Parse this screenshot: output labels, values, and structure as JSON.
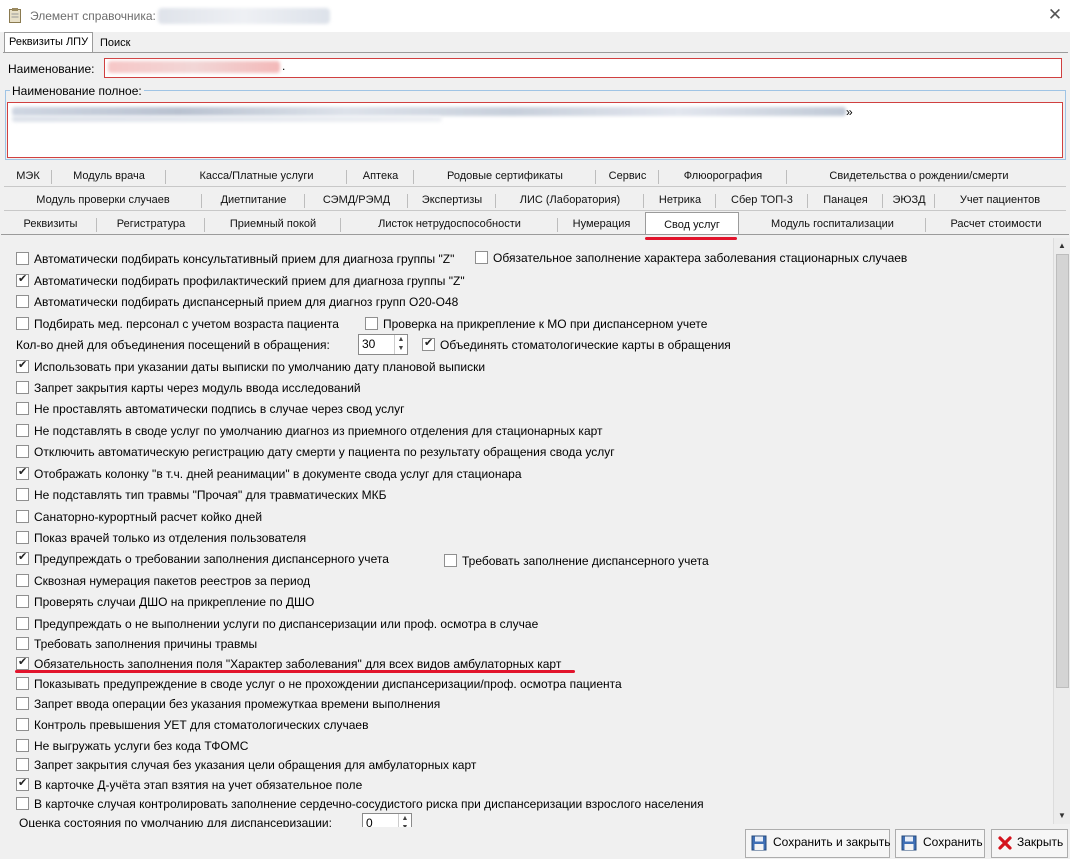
{
  "window": {
    "title": "Элемент справочника:",
    "close_icon": "close-icon"
  },
  "top_tabs": [
    {
      "label": "Реквизиты ЛПУ",
      "active": true
    },
    {
      "label": "Поиск",
      "active": false
    }
  ],
  "fields": {
    "name_label": "Наименование:",
    "name_suffix": ".",
    "full_name_label": "Наименование полное:",
    "full_name_suffix": "»"
  },
  "tab_rows": [
    [
      "МЭК",
      "Модуль врача",
      "Касса/Платные услуги",
      "Аптека",
      "Родовые сертификаты",
      "Сервис",
      "Флюорография",
      "Свидетельства о рождении/смерти"
    ],
    [
      "Модуль проверки случаев",
      "Диетпитание",
      "СЭМД/РЭМД",
      "Экспертизы",
      "ЛИС (Лаборатория)",
      "Нетрика",
      "Сбер ТОП-3",
      "Панацея",
      "ЭЮЗД",
      "Учет пациентов"
    ],
    [
      "Реквизиты",
      "Регистратура",
      "Приемный покой",
      "Листок нетрудоспособности",
      "Нумерация",
      "Свод услуг",
      "Модуль госпитализации",
      "Расчет стоимости"
    ]
  ],
  "active_tab": "Свод услуг",
  "options": [
    {
      "label": "Автоматически подбирать консультативный прием для диагноза группы \"Z\"",
      "checked": false
    },
    {
      "label": "Обязательное заполнение характера заболевания стационарных случаев",
      "checked": false
    },
    {
      "label": "Автоматически подбирать профилактический прием для диагноза группы \"Z\"",
      "checked": true
    },
    {
      "label": "Автоматически подбирать диспансерный прием для диагноз групп O20-O48",
      "checked": false
    },
    {
      "label": "Подбирать мед. персонал с учетом возраста пациента",
      "checked": false
    },
    {
      "label": "Проверка на прикрепление к МО при диспансерном учете",
      "checked": false
    },
    {
      "label": "Объединять стоматологические карты в обращения",
      "checked": true
    },
    {
      "label": "Использовать при указании даты выписки по умолчанию дату плановой выписки",
      "checked": true
    },
    {
      "label": "Запрет закрытия карты через модуль ввода исследований",
      "checked": false
    },
    {
      "label": "Не проставлять автоматически подпись в случае через свод услуг",
      "checked": false
    },
    {
      "label": "Не подставлять в своде услуг по умолчанию диагноз из приемного отделения для стационарных карт",
      "checked": false
    },
    {
      "label": "Отключить автоматическую регистрацию дату смерти у пациента по результату обращения свода услуг",
      "checked": false
    },
    {
      "label": "Отображать колонку \"в т.ч. дней реанимации\" в документе свода услуг для стационара",
      "checked": true
    },
    {
      "label": "Не подставлять тип травмы \"Прочая\" для травматических МКБ",
      "checked": false
    },
    {
      "label": "Санаторно-курортный расчет койко дней",
      "checked": false
    },
    {
      "label": "Показ врачей только из отделения пользователя",
      "checked": false
    },
    {
      "label": "Предупреждать о требовании заполнения диспансерного учета",
      "checked": true
    },
    {
      "label": "Требовать заполнение диспансерного учета",
      "checked": false
    },
    {
      "label": "Сквозная нумерация пакетов реестров за период",
      "checked": false
    },
    {
      "label": "Проверять случаи ДШО на прикрепление по ДШО",
      "checked": false
    },
    {
      "label": "Предупреждать о не выполнении услуги по диспансеризации или проф. осмотра в случае",
      "checked": false
    },
    {
      "label": "Требовать заполнения причины травмы",
      "checked": false
    },
    {
      "label": "Обязательность заполнения поля \"Характер заболевания\" для всех видов амбулаторных карт",
      "checked": true
    },
    {
      "label": "Показывать предупреждение в своде услуг о не прохождении диспансеризации/проф. осмотра пациента",
      "checked": false
    },
    {
      "label": "Запрет ввода операции без указания промежуткаа времени выполнения",
      "checked": false
    },
    {
      "label": "Контроль превышения УЕТ для стоматологических случаев",
      "checked": false
    },
    {
      "label": "Не выгружать услуги без кода ТФОМС",
      "checked": false
    },
    {
      "label": "Запрет закрытия случая без указания цели обращения для амбулаторных карт",
      "checked": false
    },
    {
      "label": "В карточке Д-учёта этап взятия на учет обязательное поле",
      "checked": true
    },
    {
      "label": "В карточке случая контролировать заполнение сердечно-сосудистого риска при диспансеризации взрослого населения",
      "checked": false
    }
  ],
  "numeric_fields": {
    "days_label": "Кол-во дней для объединения посещений в обращения:",
    "days_value": "30",
    "assessment_label": "Оценка состояния по умолчанию для диспансеризации:",
    "assessment_value": "0"
  },
  "buttons": {
    "save_close": "Сохранить и закрыть",
    "save": "Сохранить",
    "close": "Закрыть"
  },
  "colors": {
    "highlight_red": "#e2142c",
    "checkbox_border": "#8f8f8f"
  }
}
